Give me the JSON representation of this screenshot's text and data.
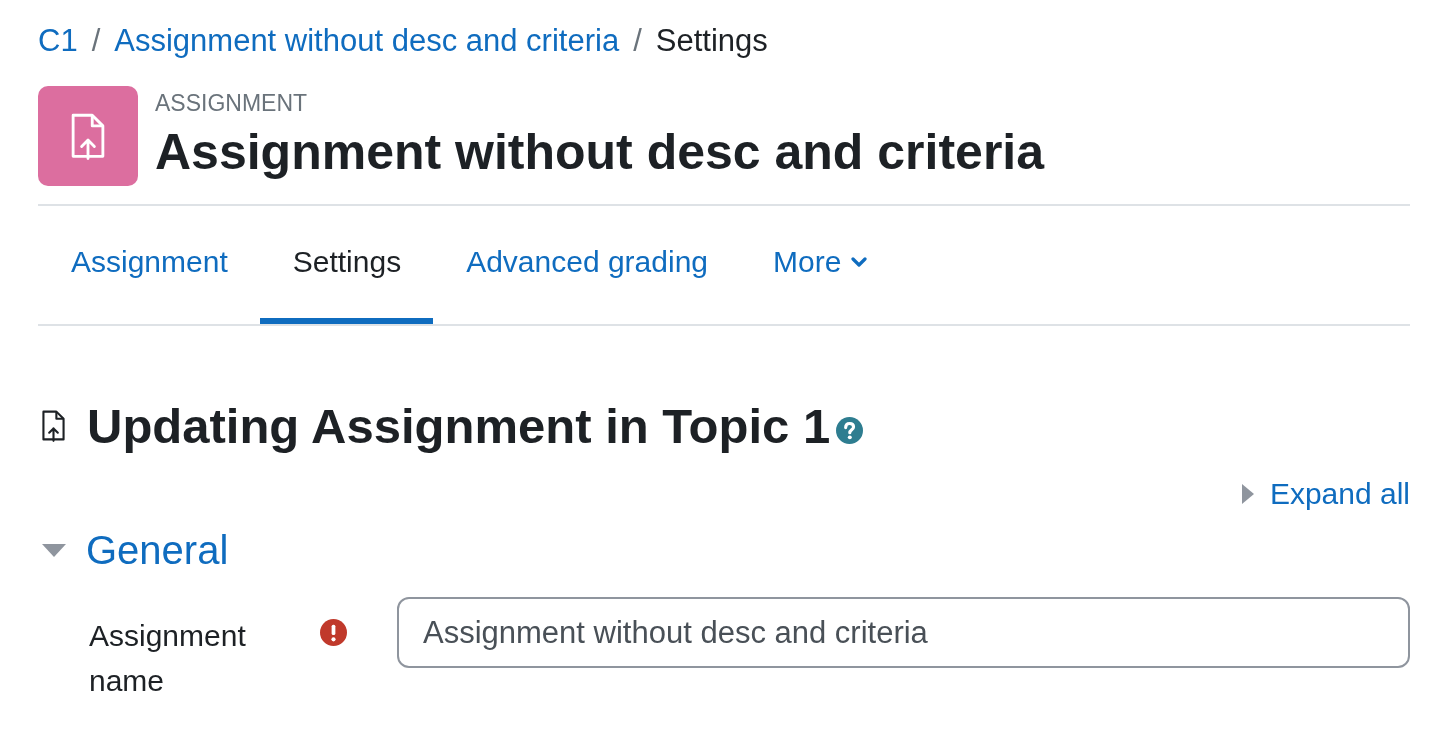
{
  "breadcrumb": [
    {
      "kind": "link",
      "label": "C1"
    },
    {
      "kind": "separator",
      "label": "/"
    },
    {
      "kind": "link",
      "label": "Assignment without desc and criteria"
    },
    {
      "kind": "separator",
      "label": "/"
    },
    {
      "kind": "current",
      "label": "Settings"
    }
  ],
  "header": {
    "activity_type": "ASSIGNMENT",
    "title": "Assignment without desc and criteria"
  },
  "tabs": [
    {
      "kind": "link",
      "label": "Assignment",
      "selected": false
    },
    {
      "kind": "link",
      "label": "Settings",
      "selected": true
    },
    {
      "kind": "link",
      "label": "Advanced grading",
      "selected": false
    },
    {
      "kind": "dropdown",
      "label": "More",
      "selected": false
    }
  ],
  "heading": {
    "text": "Updating Assignment in Topic 1",
    "help": true
  },
  "expand_all": "Expand all",
  "sections": [
    {
      "title": "General",
      "expanded": true,
      "fields": [
        {
          "label": "Assignment name",
          "required": true,
          "value": "Assignment without desc and criteria"
        }
      ]
    }
  ]
}
